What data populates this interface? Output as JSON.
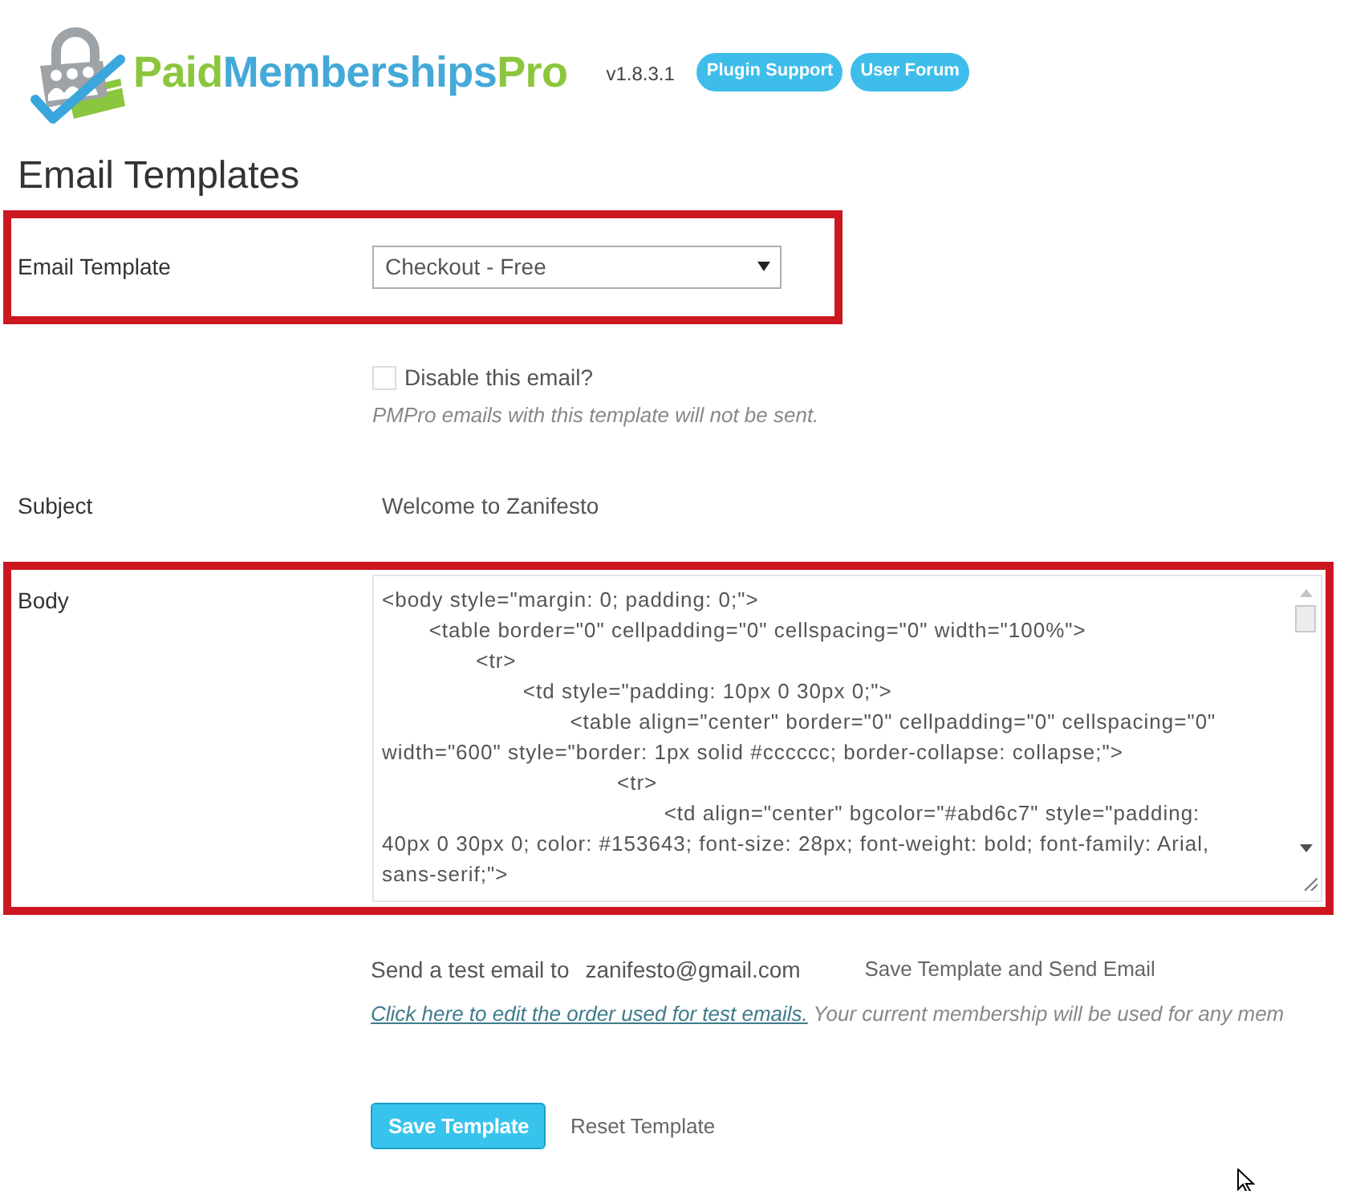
{
  "header": {
    "logo": {
      "parts": [
        {
          "text": "Paid",
          "color": "#8cc63e"
        },
        {
          "text": "Memberships",
          "color": "#44a9d8"
        },
        {
          "text": "Pro",
          "color": "#8cc63e"
        }
      ]
    },
    "version": "v1.8.3.1",
    "links": [
      "Plugin Support",
      "User Forum"
    ]
  },
  "page_title": "Email Templates",
  "template_select": {
    "label": "Email Template",
    "value": "Checkout - Free",
    "highlighted": true
  },
  "disable_email": {
    "label": "Disable this email?",
    "checked": false,
    "note": "PMPro emails with this template will not be sent."
  },
  "subject": {
    "label": "Subject",
    "value": "Welcome to Zanifesto"
  },
  "body": {
    "label": "Body",
    "value": "<body style=\"margin: 0; padding: 0;\">\n\t<table border=\"0\" cellpadding=\"0\" cellspacing=\"0\" width=\"100%\">\n\t\t<tr>\n\t\t\t<td style=\"padding: 10px 0 30px 0;\">\n\t\t\t\t<table align=\"center\" border=\"0\" cellpadding=\"0\" cellspacing=\"0\" width=\"600\" style=\"border: 1px solid #cccccc; border-collapse: collapse;\">\n\t\t\t\t\t<tr>\n\t\t\t\t\t\t<td align=\"center\" bgcolor=\"#abd6c7\" style=\"padding: 40px 0 30px 0; color: #153643; font-size: 28px; font-weight: bold; font-family: Arial, sans-serif;\">",
    "highlighted": true
  },
  "test_email": {
    "label": "Send a test email to",
    "value": "zanifesto@gmail.com",
    "button": "Save Template and Send Email",
    "link": "Click here to edit the order used for test emails.",
    "note": "Your current membership will be used for any mem"
  },
  "buttons": [
    {
      "label": "Save Template",
      "kind": "primary"
    },
    {
      "label": "Reset Template",
      "kind": "secondary"
    }
  ]
}
